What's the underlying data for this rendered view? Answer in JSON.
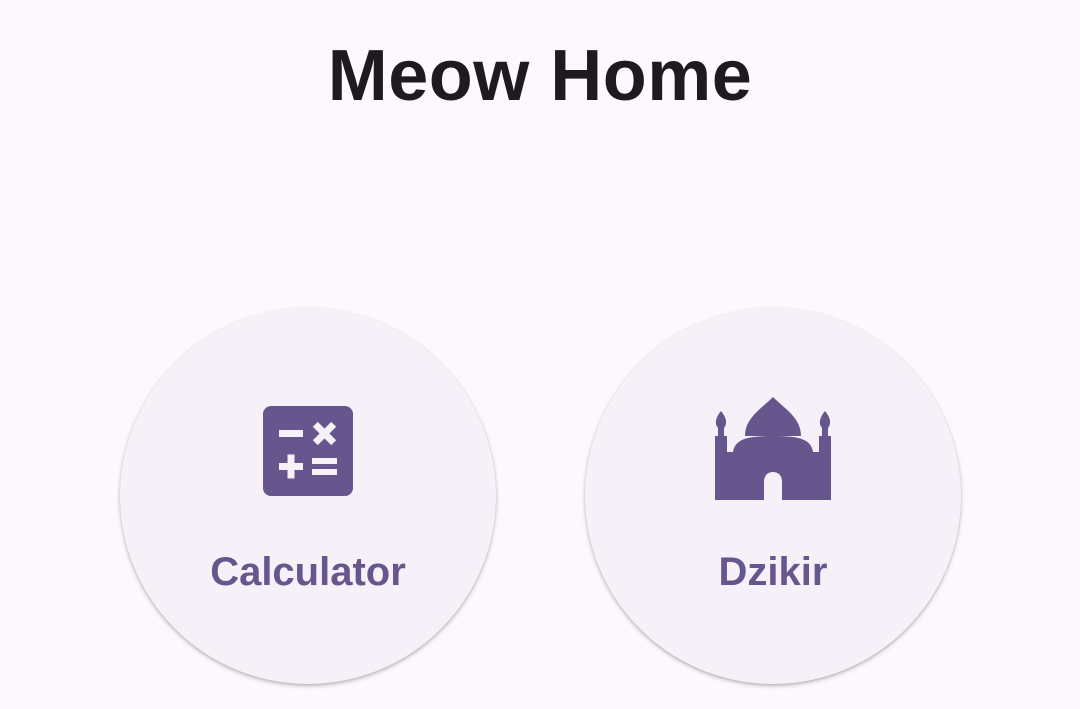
{
  "app": {
    "title": "Meow Home"
  },
  "theme": {
    "background": "#fdf7fe",
    "card_background": "#f6f1f8",
    "accent": "#67558d",
    "title_color": "#1d1b20"
  },
  "menu": {
    "items": [
      {
        "label": "Calculator",
        "icon": "calculator-icon"
      },
      {
        "label": "Dzikir",
        "icon": "mosque-icon"
      }
    ]
  }
}
